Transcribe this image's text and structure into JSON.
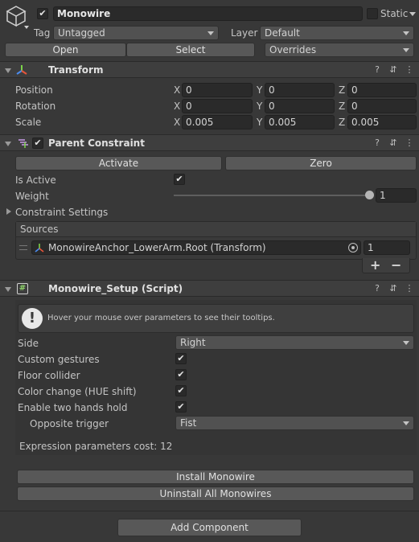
{
  "object": {
    "name": "Monowire",
    "static_label": "Static",
    "tag_label": "Tag",
    "tag_value": "Untagged",
    "layer_label": "Layer",
    "layer_value": "Default",
    "open_label": "Open",
    "select_label": "Select",
    "overrides_label": "Overrides"
  },
  "transform": {
    "title": "Transform",
    "rows": [
      {
        "label": "Position",
        "x": "0",
        "y": "0",
        "z": "0"
      },
      {
        "label": "Rotation",
        "x": "0",
        "y": "0",
        "z": "0"
      },
      {
        "label": "Scale",
        "x": "0.005",
        "y": "0.005",
        "z": "0.005"
      }
    ],
    "axis": {
      "x": "X",
      "y": "Y",
      "z": "Z"
    }
  },
  "parent_constraint": {
    "title": "Parent Constraint",
    "activate_label": "Activate",
    "zero_label": "Zero",
    "is_active_label": "Is Active",
    "weight_label": "Weight",
    "weight_value": "1",
    "weight_fraction": 1.0,
    "constraint_settings_label": "Constraint Settings",
    "sources_label": "Sources",
    "source_item": "MonowireAnchor_LowerArm.Root (Transform)",
    "source_weight": "1",
    "plus": "+",
    "minus": "−"
  },
  "setup": {
    "title": "Monowire_Setup (Script)",
    "hint": "Hover your mouse over parameters to see their tooltips.",
    "side_label": "Side",
    "side_value": "Right",
    "custom_gestures_label": "Custom gestures",
    "floor_collider_label": "Floor collider",
    "color_change_label": "Color change (HUE shift)",
    "two_hands_label": "Enable two hands hold",
    "opposite_trigger_label": "Opposite trigger",
    "opposite_trigger_value": "Fist",
    "cost_text": "Expression parameters cost: 12",
    "install_label": "Install Monowire",
    "uninstall_label": "Uninstall All Monowires"
  },
  "add_component_label": "Add Component",
  "colors": {
    "background": "#383838",
    "header": "#3e3e3e",
    "field": "#2a2a2a",
    "button": "#585858"
  }
}
